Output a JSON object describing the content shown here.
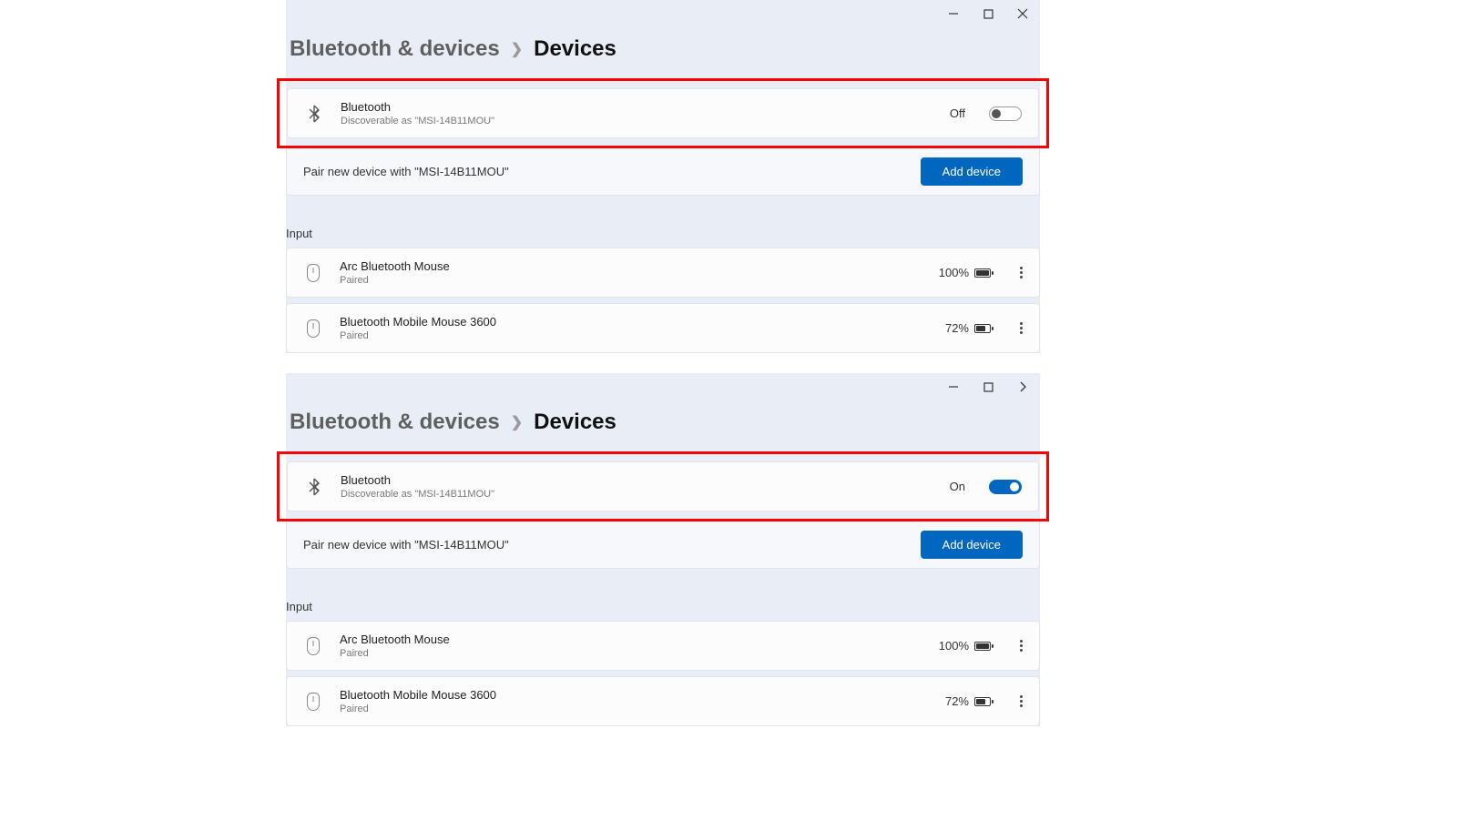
{
  "window_off": {
    "breadcrumb": {
      "parent": "Bluetooth & devices",
      "current": "Devices"
    },
    "bluetooth": {
      "title": "Bluetooth",
      "subtitle": "Discoverable as \"MSI-14B11MOU\"",
      "state_label": "Off"
    },
    "pair": {
      "text": "Pair new device with \"MSI-14B11MOU\"",
      "button": "Add device"
    },
    "input_label": "Input",
    "devices": [
      {
        "name": "Arc Bluetooth Mouse",
        "status": "Paired",
        "battery": "100%",
        "fill": 14
      },
      {
        "name": "Bluetooth Mobile Mouse 3600",
        "status": "Paired",
        "battery": "72%",
        "fill": 10
      }
    ]
  },
  "window_on": {
    "breadcrumb": {
      "parent": "Bluetooth & devices",
      "current": "Devices"
    },
    "bluetooth": {
      "title": "Bluetooth",
      "subtitle": "Discoverable as \"MSI-14B11MOU\"",
      "state_label": "On"
    },
    "pair": {
      "text": "Pair new device with \"MSI-14B11MOU\"",
      "button": "Add device"
    },
    "input_label": "Input",
    "devices": [
      {
        "name": "Arc Bluetooth Mouse",
        "status": "Paired",
        "battery": "100%",
        "fill": 14
      },
      {
        "name": "Bluetooth Mobile Mouse 3600",
        "status": "Paired",
        "battery": "72%",
        "fill": 10
      }
    ]
  }
}
